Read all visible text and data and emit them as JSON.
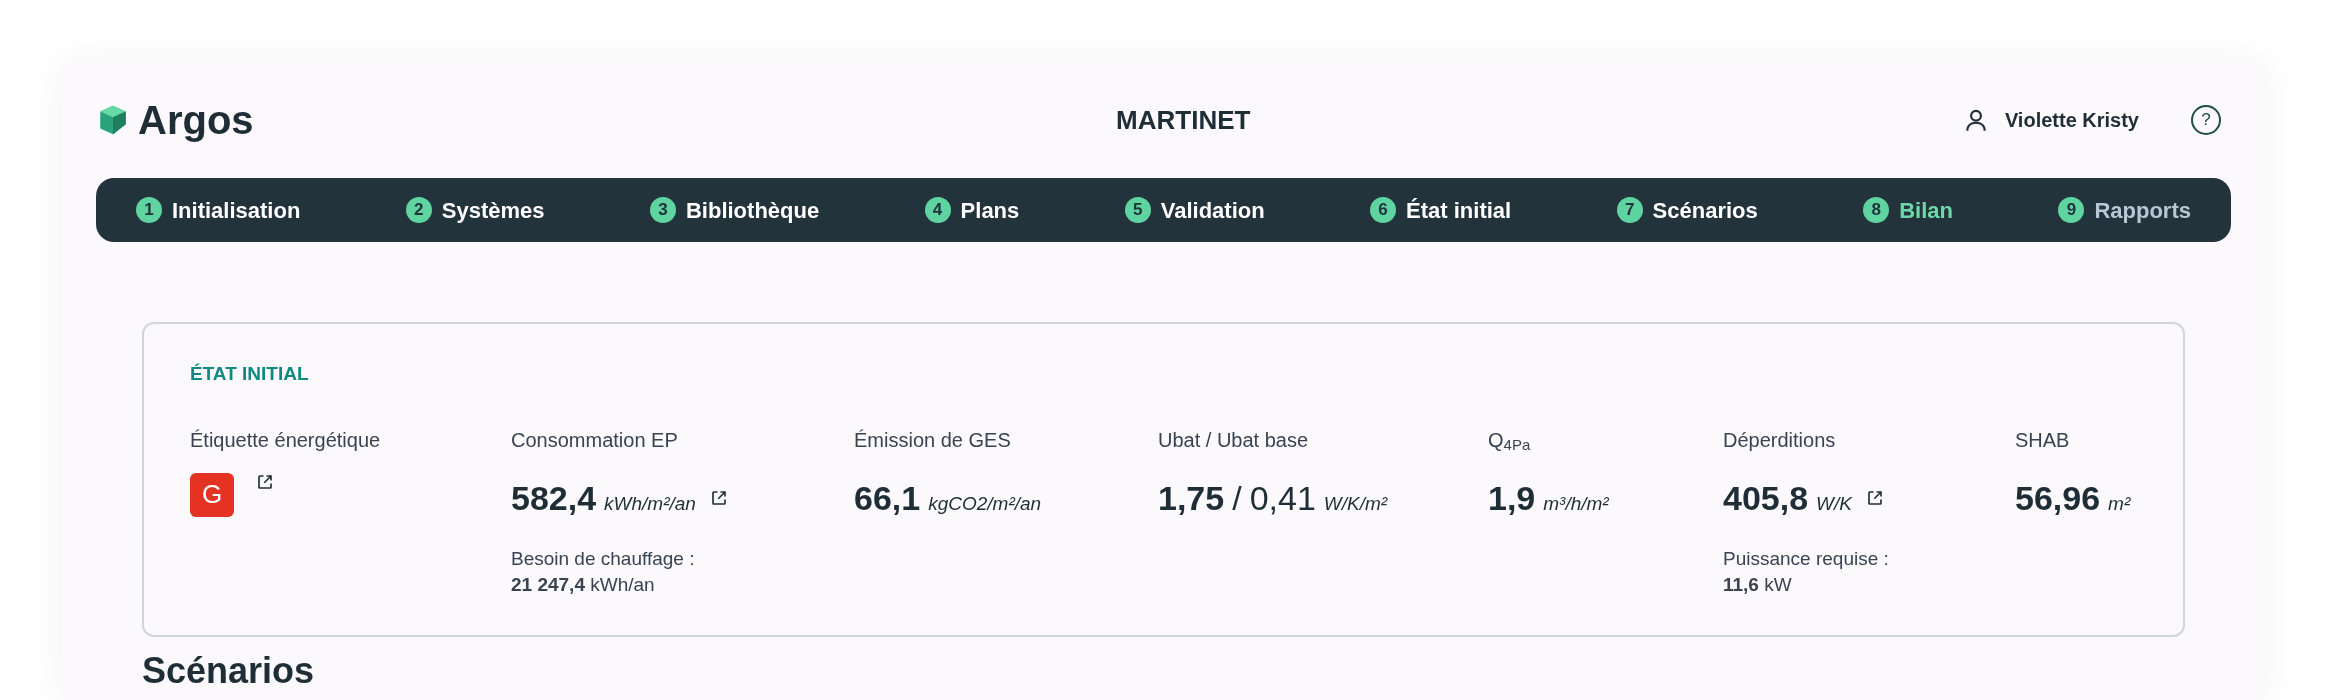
{
  "header": {
    "brand": "Argos",
    "project": "MARTINET",
    "user": "Violette Kristy",
    "help": "?"
  },
  "steps": [
    {
      "number": "1",
      "label": "Initialisation",
      "selected": false,
      "disabled": false
    },
    {
      "number": "2",
      "label": "Systèmes",
      "selected": false,
      "disabled": false
    },
    {
      "number": "3",
      "label": "Bibliothèque",
      "selected": false,
      "disabled": false
    },
    {
      "number": "4",
      "label": "Plans",
      "selected": false,
      "disabled": false
    },
    {
      "number": "5",
      "label": "Validation",
      "selected": false,
      "disabled": false
    },
    {
      "number": "6",
      "label": "État initial",
      "selected": false,
      "disabled": false
    },
    {
      "number": "7",
      "label": "Scénarios",
      "selected": false,
      "disabled": false
    },
    {
      "number": "8",
      "label": "Bilan",
      "selected": true,
      "disabled": false
    },
    {
      "number": "9",
      "label": "Rapports",
      "selected": false,
      "disabled": true
    }
  ],
  "summary": {
    "title": "ÉTAT INITIAL",
    "metrics": [
      {
        "kind": "grade",
        "label": "Étiquette énergétique",
        "grade": "G",
        "color": "#e53323",
        "link": true
      },
      {
        "kind": "value",
        "label": "Consommation EP",
        "value": "582,4",
        "unit": "kWh/m²/an",
        "link": true,
        "note": {
          "label": "Besoin de chauffage :",
          "value": "21 247,4",
          "unit": "kWh/an"
        }
      },
      {
        "kind": "value",
        "label": "Émission de GES",
        "value": "66,1",
        "unit": "kgCO2/m²/an",
        "link": false
      },
      {
        "kind": "ratio",
        "label": "Ubat / Ubat base",
        "value": "1,75",
        "separator": "/",
        "second_value": "0,41",
        "unit": "W/K/m²",
        "link": false
      },
      {
        "kind": "value",
        "label": "Q$_{4Pa}$",
        "value": "1,9",
        "unit": "m³/h/m²",
        "link": false
      },
      {
        "kind": "value",
        "label": "Déperditions",
        "value": "405,8",
        "unit": "W/K",
        "link": true,
        "note": {
          "label": "Puissance requise :",
          "value": "11,6",
          "unit": "kW"
        }
      },
      {
        "kind": "value",
        "label": "SHAB",
        "value": "56,96",
        "unit": "m²",
        "link": false
      }
    ]
  },
  "section_title": "Scénarios"
}
